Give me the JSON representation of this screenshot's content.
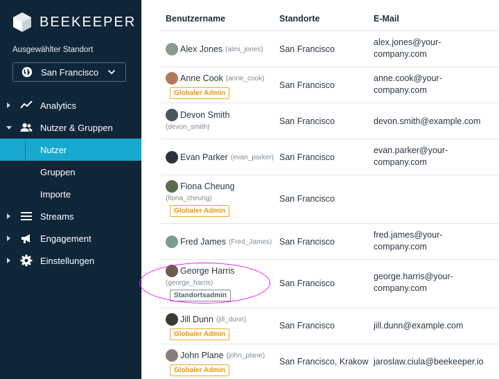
{
  "brand": {
    "name": "BEEKEEPER"
  },
  "location": {
    "label": "Ausgewählter Standort",
    "value": "San Francisco"
  },
  "nav": {
    "analytics": "Analytics",
    "users_groups": "Nutzer & Gruppen",
    "users": "Nutzer",
    "groups": "Gruppen",
    "imports": "Importe",
    "streams": "Streams",
    "engagement": "Engagement",
    "settings": "Einstellungen"
  },
  "table": {
    "headers": {
      "username": "Benutzername",
      "locations": "Standorte",
      "email": "E-Mail"
    },
    "rows": [
      {
        "name": "Alex Jones",
        "handle": "(alex_jones)",
        "badge": "",
        "location": "San Francisco",
        "email1": "alex.jones@your-",
        "email2": "company.com"
      },
      {
        "name": "Anne Cook",
        "handle": "(anne_cook)",
        "badge": "Globaler Admin",
        "location": "San Francisco",
        "email1": "anne.cook@your-",
        "email2": "company.com"
      },
      {
        "name": "Devon Smith",
        "handle": "(devon_smith)",
        "badge": "",
        "location": "San Francisco",
        "email1": "devon.smith@example.com",
        "email2": ""
      },
      {
        "name": "Evan Parker",
        "handle": "(evan_parker)",
        "badge": "",
        "location": "San Francisco",
        "email1": "evan.parker@your-",
        "email2": "company.com"
      },
      {
        "name": "Fiona Cheung",
        "handle": "(fiona_cheung)",
        "badge": "Globaler Admin",
        "location": "San Francisco",
        "email1": "",
        "email2": ""
      },
      {
        "name": "Fred James",
        "handle": "(Fred_James)",
        "badge": "",
        "location": "San Francisco",
        "email1": "fred.james@your-",
        "email2": "company.com"
      },
      {
        "name": "George Harris",
        "handle": "(george_harris)",
        "badge": "Standortsadmin",
        "location": "San Francisco",
        "email1": "george.harris@your-",
        "email2": "company.com"
      },
      {
        "name": "Jill Dunn",
        "handle": "(jill_dunn)",
        "badge": "Globaler Admin",
        "location": "San Francisco",
        "email1": "jill.dunn@example.com",
        "email2": ""
      },
      {
        "name": "John Plane",
        "handle": "(john_plane)",
        "badge": "Globaler Admin",
        "location": "San Francisco, Krakow",
        "email1": "jaroslaw.ciula@beekeeper.io",
        "email2": ""
      }
    ]
  },
  "colors": {
    "sidebar": "#0f2538",
    "active": "#17a9cf",
    "admin_badge": "#f0a91e",
    "highlight": "#ee11ee"
  }
}
